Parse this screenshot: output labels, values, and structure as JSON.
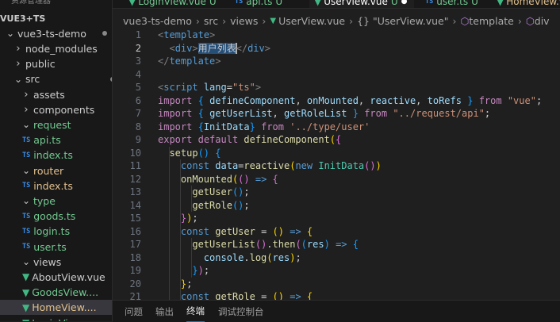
{
  "explorer": {
    "header_partial": "资源管理器",
    "items": [
      {
        "label": "VUE3+TS",
        "chev": "",
        "icon": "",
        "status": "",
        "bold": true
      },
      {
        "label": "vue3-ts-demo",
        "chev": "∨",
        "icon": "",
        "status": "dot"
      },
      {
        "label": "node_modules",
        "chev": "›",
        "icon": "",
        "status": ""
      },
      {
        "label": "public",
        "chev": "›",
        "icon": "",
        "status": ""
      },
      {
        "label": "src",
        "chev": "∨",
        "icon": "",
        "status": "dot"
      },
      {
        "label": "assets",
        "chev": "›",
        "icon": "",
        "status": ""
      },
      {
        "label": "components",
        "chev": "›",
        "icon": "",
        "status": ""
      },
      {
        "label": "request",
        "chev": "∨",
        "icon": "",
        "status": "dot"
      },
      {
        "label": "api.ts",
        "chev": "",
        "icon": "TS",
        "status": "U"
      },
      {
        "label": "index.ts",
        "chev": "",
        "icon": "TS",
        "status": "U"
      },
      {
        "label": "router",
        "chev": "∨",
        "icon": "",
        "status": "dot"
      },
      {
        "label": "index.ts",
        "chev": "",
        "icon": "TS",
        "status": "M"
      },
      {
        "label": "type",
        "chev": "∨",
        "icon": "",
        "status": "dot"
      },
      {
        "label": "goods.ts",
        "chev": "",
        "icon": "TS",
        "status": "U"
      },
      {
        "label": "login.ts",
        "chev": "",
        "icon": "TS",
        "status": "U"
      },
      {
        "label": "user.ts",
        "chev": "",
        "icon": "TS",
        "status": "U"
      },
      {
        "label": "views",
        "chev": "∨",
        "icon": "",
        "status": "dot"
      },
      {
        "label": "AboutView.vue",
        "chev": "",
        "icon": "V",
        "status": ""
      },
      {
        "label": "GoodsView....",
        "chev": "",
        "icon": "V",
        "status": "U"
      },
      {
        "label": "HomeView....",
        "chev": "",
        "icon": "V",
        "status": "M"
      },
      {
        "label": "LoginView....",
        "chev": "",
        "icon": "V",
        "status": ""
      }
    ]
  },
  "tabs": [
    {
      "label": "LoginView.vue",
      "badge": "U",
      "active": false
    },
    {
      "label": "api.ts",
      "badge": "U",
      "active": false
    },
    {
      "label": "UserView.vue",
      "badge": "U",
      "active": true
    },
    {
      "label": "user.ts",
      "badge": "U",
      "active": false
    },
    {
      "label": "HomeView.vue",
      "badge": "",
      "active": false
    }
  ],
  "breadcrumb": [
    "vue3-ts-demo",
    "src",
    "views",
    "UserView.vue",
    "{} \"UserView.vue\"",
    "template",
    "div"
  ],
  "editor": {
    "current_line": 2,
    "lines": [
      [
        [
          "t",
          "<"
        ],
        [
          "tag",
          "template"
        ],
        [
          "t",
          ">"
        ]
      ],
      [
        [
          "txt",
          "  "
        ],
        [
          "t",
          "<"
        ],
        [
          "tag",
          "div"
        ],
        [
          "t",
          ">"
        ],
        [
          "sel",
          "用户列表"
        ],
        [
          "cur",
          ""
        ],
        [
          "t",
          "</"
        ],
        [
          "tag",
          "div"
        ],
        [
          "t",
          ">"
        ]
      ],
      [
        [
          "t",
          "</"
        ],
        [
          "tag",
          "template"
        ],
        [
          "t",
          ">"
        ]
      ],
      [],
      [
        [
          "t",
          "<"
        ],
        [
          "tag",
          "script"
        ],
        [
          "txt",
          " "
        ],
        [
          "attr",
          "lang"
        ],
        [
          "txt",
          "="
        ],
        [
          "str",
          "\"ts\""
        ],
        [
          "t",
          ">"
        ]
      ],
      [
        [
          "kw",
          "import"
        ],
        [
          "txt",
          " "
        ],
        [
          "p3",
          "{"
        ],
        [
          "txt",
          " "
        ],
        [
          "id",
          "defineComponent"
        ],
        [
          "txt",
          ", "
        ],
        [
          "id",
          "onMounted"
        ],
        [
          "txt",
          ", "
        ],
        [
          "id",
          "reactive"
        ],
        [
          "txt",
          ", "
        ],
        [
          "id",
          "toRefs"
        ],
        [
          "txt",
          " "
        ],
        [
          "p3",
          "}"
        ],
        [
          "txt",
          " "
        ],
        [
          "kw",
          "from"
        ],
        [
          "txt",
          " "
        ],
        [
          "str",
          "\"vue\""
        ],
        [
          "txt",
          ";"
        ]
      ],
      [
        [
          "kw",
          "import"
        ],
        [
          "txt",
          " "
        ],
        [
          "p3",
          "{"
        ],
        [
          "txt",
          " "
        ],
        [
          "id",
          "getUserList"
        ],
        [
          "txt",
          ", "
        ],
        [
          "id",
          "getRoleList"
        ],
        [
          "txt",
          " "
        ],
        [
          "p3",
          "}"
        ],
        [
          "txt",
          " "
        ],
        [
          "kw",
          "from"
        ],
        [
          "txt",
          " "
        ],
        [
          "str",
          "\"../request/api\""
        ],
        [
          "txt",
          ";"
        ]
      ],
      [
        [
          "kw",
          "import"
        ],
        [
          "txt",
          " "
        ],
        [
          "p3",
          "{"
        ],
        [
          "id",
          "InitData"
        ],
        [
          "p3",
          "}"
        ],
        [
          "txt",
          " "
        ],
        [
          "kw",
          "from"
        ],
        [
          "txt",
          " "
        ],
        [
          "str",
          "'../type/user'"
        ]
      ],
      [
        [
          "kw",
          "export"
        ],
        [
          "txt",
          " "
        ],
        [
          "kw",
          "default"
        ],
        [
          "txt",
          " "
        ],
        [
          "fn",
          "defineComponent"
        ],
        [
          "p1",
          "("
        ],
        [
          "p2",
          "{"
        ]
      ],
      [
        [
          "txt",
          "  "
        ],
        [
          "fn",
          "setup"
        ],
        [
          "p3",
          "()"
        ],
        [
          "txt",
          " "
        ],
        [
          "p3",
          "{"
        ]
      ],
      [
        [
          "txt",
          "    "
        ],
        [
          "sk",
          "const"
        ],
        [
          "txt",
          " "
        ],
        [
          "id",
          "data"
        ],
        [
          "txt",
          "="
        ],
        [
          "fn",
          "reactive"
        ],
        [
          "p1",
          "("
        ],
        [
          "sk",
          "new"
        ],
        [
          "txt",
          " "
        ],
        [
          "cls",
          "InitData"
        ],
        [
          "p2",
          "()"
        ],
        [
          "p1",
          ")"
        ]
      ],
      [
        [
          "txt",
          "    "
        ],
        [
          "fn",
          "onMounted"
        ],
        [
          "p1",
          "("
        ],
        [
          "p2",
          "()"
        ],
        [
          "txt",
          " "
        ],
        [
          "sk",
          "=>"
        ],
        [
          "txt",
          " "
        ],
        [
          "p2",
          "{"
        ]
      ],
      [
        [
          "txt",
          "      "
        ],
        [
          "fn",
          "getUser"
        ],
        [
          "p3",
          "()"
        ],
        [
          "txt",
          ";"
        ]
      ],
      [
        [
          "txt",
          "      "
        ],
        [
          "fn",
          "getRole"
        ],
        [
          "p3",
          "()"
        ],
        [
          "txt",
          ";"
        ]
      ],
      [
        [
          "txt",
          "    "
        ],
        [
          "p2",
          "}"
        ],
        [
          "p1",
          ")"
        ],
        [
          "txt",
          ";"
        ]
      ],
      [
        [
          "txt",
          "    "
        ],
        [
          "sk",
          "const"
        ],
        [
          "txt",
          " "
        ],
        [
          "fn",
          "getUser"
        ],
        [
          "txt",
          " = "
        ],
        [
          "p1",
          "()"
        ],
        [
          "txt",
          " "
        ],
        [
          "sk",
          "=>"
        ],
        [
          "txt",
          " "
        ],
        [
          "p1",
          "{"
        ]
      ],
      [
        [
          "txt",
          "      "
        ],
        [
          "fn",
          "getUserList"
        ],
        [
          "p2",
          "()"
        ],
        [
          "txt",
          "."
        ],
        [
          "fn",
          "then"
        ],
        [
          "p2",
          "("
        ],
        [
          "p3",
          "("
        ],
        [
          "id",
          "res"
        ],
        [
          "p3",
          ")"
        ],
        [
          "txt",
          " "
        ],
        [
          "sk",
          "=>"
        ],
        [
          "txt",
          " "
        ],
        [
          "p3",
          "{"
        ]
      ],
      [
        [
          "txt",
          "        "
        ],
        [
          "id",
          "console"
        ],
        [
          "txt",
          "."
        ],
        [
          "fn",
          "log"
        ],
        [
          "p1",
          "("
        ],
        [
          "id",
          "res"
        ],
        [
          "p1",
          ")"
        ],
        [
          "txt",
          ";"
        ]
      ],
      [
        [
          "txt",
          "      "
        ],
        [
          "p3",
          "}"
        ],
        [
          "p2",
          ")"
        ],
        [
          "txt",
          ";"
        ]
      ],
      [
        [
          "txt",
          "    "
        ],
        [
          "p1",
          "}"
        ],
        [
          "txt",
          ";"
        ]
      ],
      [
        [
          "txt",
          "    "
        ],
        [
          "sk",
          "const"
        ],
        [
          "txt",
          " "
        ],
        [
          "fn",
          "getRole"
        ],
        [
          "txt",
          " = "
        ],
        [
          "p1",
          "()"
        ],
        [
          "txt",
          " "
        ],
        [
          "sk",
          "=>"
        ],
        [
          "txt",
          " "
        ],
        [
          "p1",
          "{"
        ]
      ]
    ]
  },
  "panel_tabs": [
    {
      "label": "问题",
      "active": false
    },
    {
      "label": "输出",
      "active": false
    },
    {
      "label": "终端",
      "active": true
    },
    {
      "label": "调试控制台",
      "active": false
    }
  ],
  "colors": {
    "untracked": "#73c991",
    "modified": "#e2c08d",
    "accent": "#0078d4"
  }
}
